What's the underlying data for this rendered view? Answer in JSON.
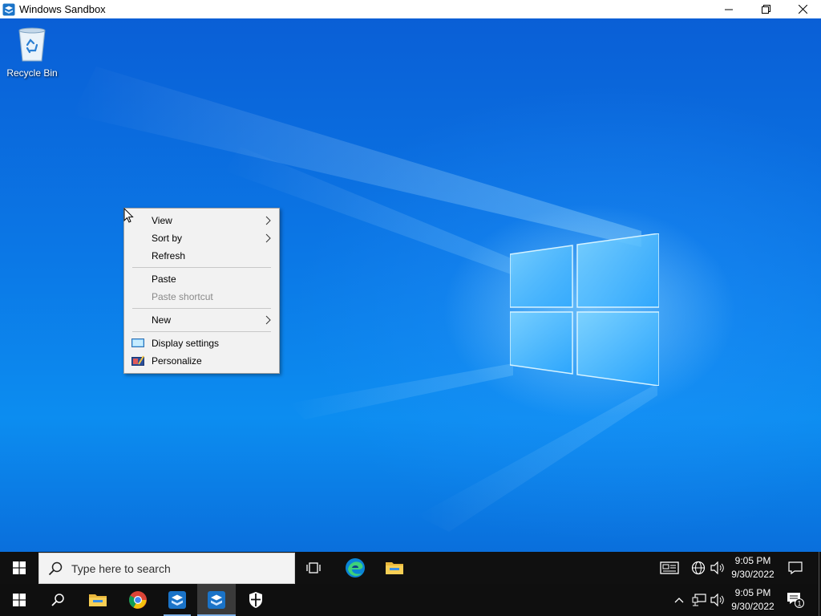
{
  "window": {
    "title": "Windows Sandbox"
  },
  "desktop": {
    "icons": [
      {
        "label": "Recycle Bin",
        "icon": "recycle-bin-icon"
      }
    ]
  },
  "context_menu": {
    "items": {
      "view": "View",
      "sort_by": "Sort by",
      "refresh": "Refresh",
      "paste": "Paste",
      "paste_shortcut": "Paste shortcut",
      "new": "New",
      "display_settings": "Display settings",
      "personalize": "Personalize"
    }
  },
  "taskbar_inner": {
    "search_placeholder": "Type here to search",
    "pinned": [
      "task-view-icon",
      "edge-icon",
      "file-explorer-icon"
    ],
    "clock": {
      "time": "9:05 PM",
      "date": "9/30/2022"
    }
  },
  "taskbar_host": {
    "pinned": [
      "search-icon",
      "file-explorer-icon",
      "chrome-icon",
      "sandbox-icon",
      "sandbox-icon",
      "security-icon"
    ],
    "clock": {
      "time": "9:05 PM",
      "date": "9/30/2022"
    },
    "notification_count": "1"
  },
  "colors": {
    "accent": "#0b78e6",
    "taskbar": "#101010",
    "menu_bg": "#f2f2f2"
  }
}
